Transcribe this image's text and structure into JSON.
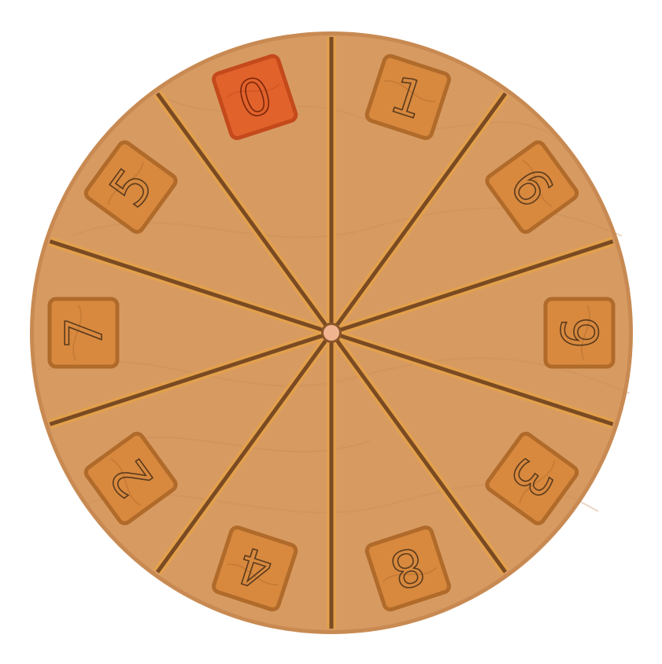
{
  "wheel": {
    "colors": {
      "board": "#d79b62",
      "board_edge": "#c88a52",
      "groove_dark": "#7a4a22",
      "groove_light": "#e3a04c",
      "tile": "#d8893e",
      "tile_border": "#b06a2a",
      "tile_highlight": "#e2622c",
      "tile_highlight_border": "#c44a1c",
      "hub": "#f0b491",
      "hub_ring": "#8a5528"
    },
    "tiles": [
      {
        "digit": "1",
        "highlighted": false
      },
      {
        "digit": "6",
        "highlighted": false
      },
      {
        "digit": "9",
        "highlighted": false
      },
      {
        "digit": "3",
        "highlighted": false
      },
      {
        "digit": "8",
        "highlighted": false
      },
      {
        "digit": "4",
        "highlighted": false
      },
      {
        "digit": "2",
        "highlighted": false
      },
      {
        "digit": "7",
        "highlighted": false
      },
      {
        "digit": "5",
        "highlighted": false
      },
      {
        "digit": "0",
        "highlighted": true
      }
    ]
  }
}
